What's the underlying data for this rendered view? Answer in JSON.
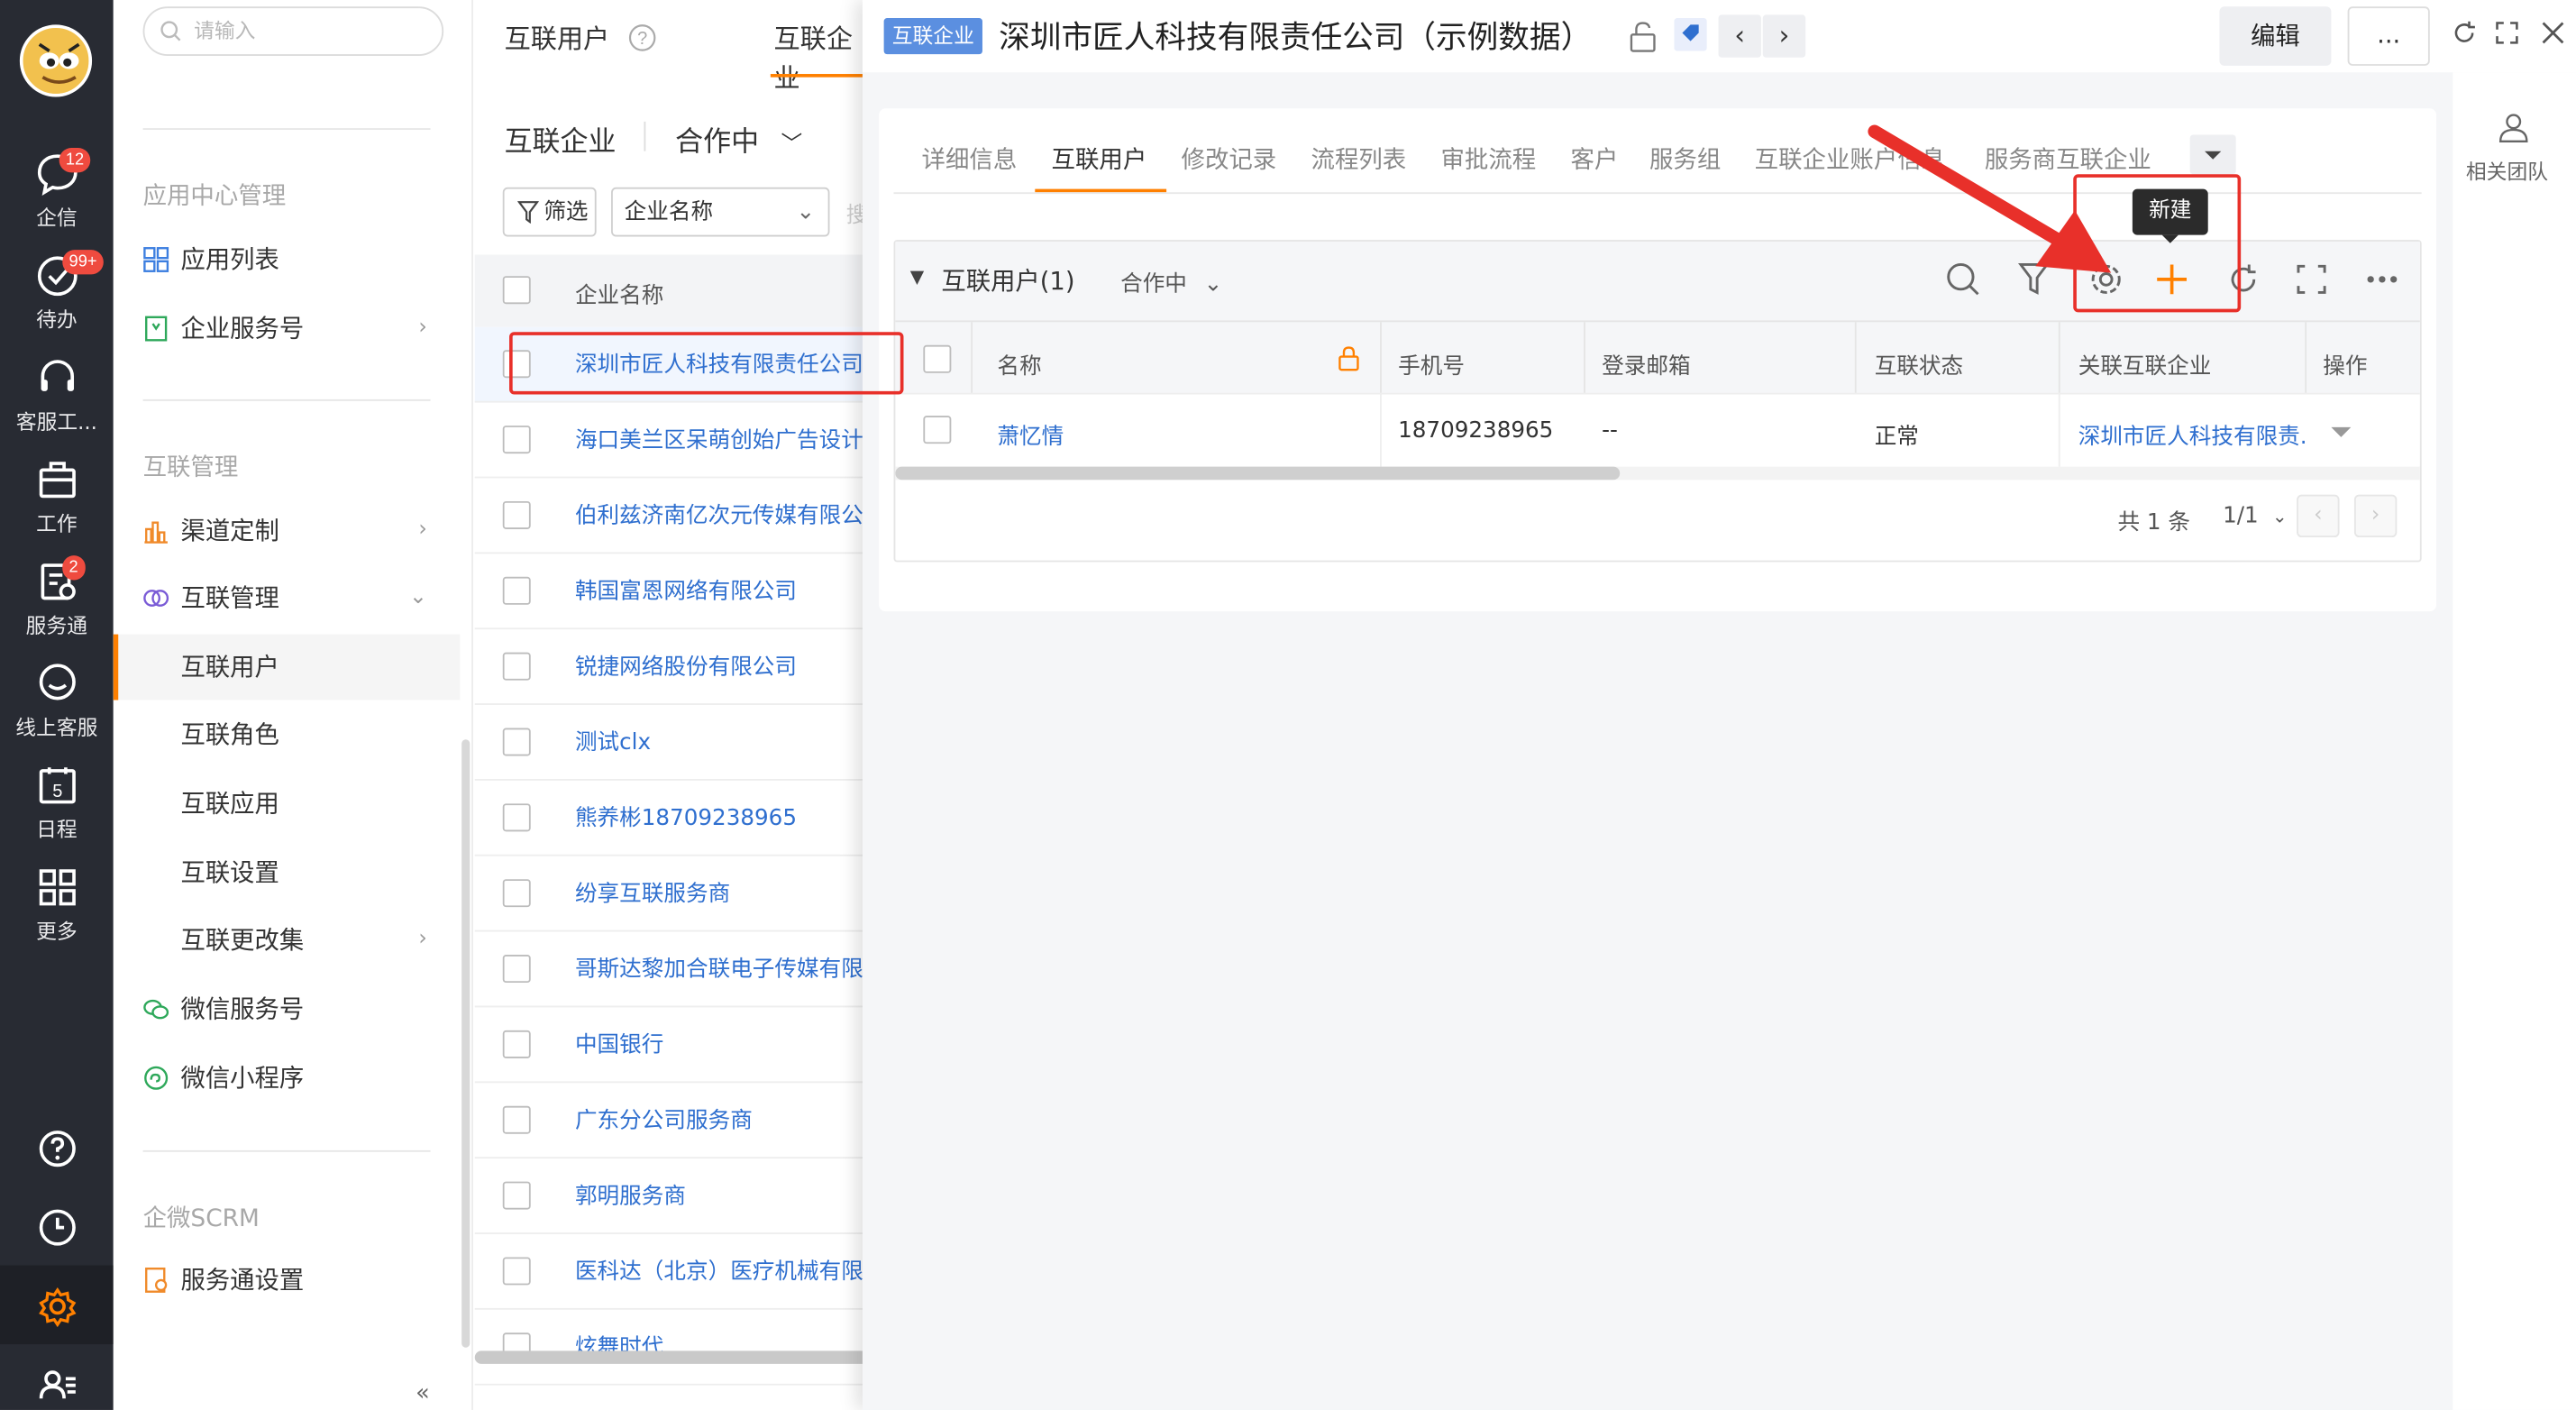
{
  "rail": {
    "items": [
      {
        "label": "企信",
        "icon": "chat-bubble-icon",
        "badge": "12"
      },
      {
        "label": "待办",
        "icon": "check-circle-icon",
        "badge": "99+"
      },
      {
        "label": "客服工...",
        "icon": "headset-icon",
        "badge": ""
      },
      {
        "label": "工作",
        "icon": "briefcase-icon",
        "badge": ""
      },
      {
        "label": "服务通",
        "icon": "service-icon",
        "badge": "2"
      },
      {
        "label": "线上客服",
        "icon": "smile-chat-icon",
        "badge": ""
      },
      {
        "label": "日程",
        "icon": "calendar-icon",
        "badge": "",
        "day": "5"
      },
      {
        "label": "更多",
        "icon": "grid-icon",
        "badge": ""
      }
    ]
  },
  "nav": {
    "search_placeholder": "请输入",
    "section_app": "应用中心管理",
    "app_list": "应用列表",
    "ent_service": "企业服务号",
    "section_interconnect": "互联管理",
    "channel": "渠道定制",
    "interconnect_mgmt": "互联管理",
    "sub_users": "互联用户",
    "sub_roles": "互联角色",
    "sub_apps": "互联应用",
    "sub_settings": "互联设置",
    "sub_changes": "互联更改集",
    "wechat_service": "微信服务号",
    "wechat_mini": "微信小程序",
    "section_scrm": "企微SCRM",
    "service_settings": "服务通设置",
    "collapse": "«"
  },
  "mid": {
    "tab1": "互联用户",
    "tab2": "互联企业",
    "title": "互联企业",
    "status": "合作中",
    "filter": "筛选",
    "select": "企业名称",
    "search_hint": "搜",
    "col_name": "企业名称",
    "rows": [
      "深圳市匠人科技有限责任公司",
      "海口美兰区呆萌创始广告设计店",
      "伯利兹济南亿次元传媒有限公司",
      "韩国富恩网络有限公司",
      "锐捷网络股份有限公司",
      "测试clx",
      "熊养彬18709238965",
      "纷享互联服务商",
      "哥斯达黎加合联电子传媒有限公司",
      "中国银行",
      "广东分公司服务商",
      "郭明服务商",
      "医科达（北京）医疗机械有限公司",
      "炫舞时代"
    ]
  },
  "drawer": {
    "tag": "互联企业",
    "title": "深圳市匠人科技有限责任公司（示例数据）",
    "edit": "编辑",
    "more": "...",
    "tabs": [
      "详细信息",
      "互联用户",
      "修改记录",
      "流程列表",
      "审批流程",
      "客户",
      "服务组",
      "互联企业账户信息",
      "服务商互联企业"
    ],
    "tooltip": "新建",
    "table_title": "互联用户(1)",
    "table_status": "合作中",
    "columns": [
      "名称",
      "手机号",
      "登录邮箱",
      "互联状态",
      "关联互联企业",
      "操作"
    ],
    "row": {
      "name": "萧忆情",
      "phone": "18709238965",
      "email": "--",
      "status": "正常",
      "company": "深圳市匠人科技有限责..."
    },
    "pager_total": "共 1 条",
    "pager_page": "1/1",
    "related_team": "相关团队"
  },
  "colors": {
    "accent": "#ff8000",
    "link": "#2f6fcf",
    "annotation_red": "#e8302a",
    "rail_bg": "#282b33"
  }
}
